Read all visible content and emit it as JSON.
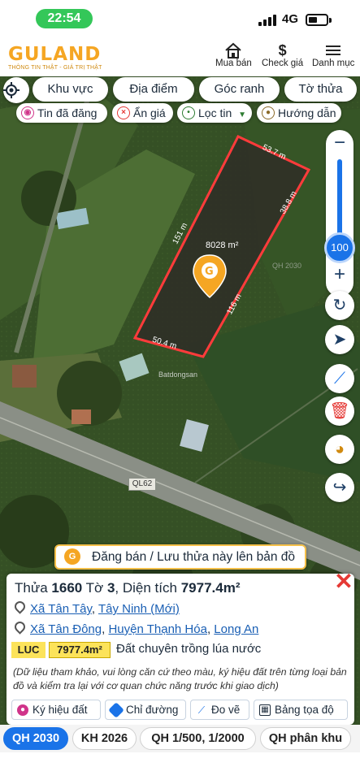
{
  "status": {
    "time": "22:54",
    "network": "4G"
  },
  "header": {
    "logo": "GULAND",
    "tagline": "THÔNG TIN THẬT - GIÁ TRỊ THẬT",
    "buttons": [
      {
        "label": "Mua bán",
        "icon": "house-icon"
      },
      {
        "label": "Check giá",
        "icon": "dollar-icon"
      },
      {
        "label": "Danh mục",
        "icon": "menu-icon"
      }
    ]
  },
  "map": {
    "top_pills": [
      "Khu vực",
      "Địa điểm",
      "Góc ranh",
      "Tờ thửa"
    ],
    "chips": [
      "Tin đã đăng",
      "Ẩn giá",
      "Lọc tin",
      "Hướng dẫn"
    ],
    "parcel": {
      "area_label": "8028 m²",
      "edges": [
        "53.7 m",
        "38.8 m",
        "116 m",
        "50.4 m",
        "151 m"
      ]
    },
    "road_label": "QL62",
    "watermark": "Batdongsan",
    "faded_label": "QH 2030",
    "zoom": {
      "value": "100",
      "minus": "−",
      "plus": "+"
    },
    "cta": "Đăng bán / Lưu thửa này lên bản đồ"
  },
  "panel": {
    "title_prefix": "Thửa",
    "parcel_no": "1660",
    "sheet_prefix": "Tờ",
    "sheet_no": "3",
    "area_prefix": ", Diện tích",
    "area": "7977.4m²",
    "new_address": {
      "commune": "Xã Tân Tây",
      "province": "Tây Ninh (Mới)"
    },
    "old_address": {
      "commune": "Xã Tân Đông",
      "district": "Huyện Thạnh Hóa",
      "province": "Long An"
    },
    "land_code": "LUC",
    "land_area": "7977.4m²",
    "land_type": "Đất chuyên trồng lúa nước",
    "note": "(Dữ liệu tham khảo, vui lòng căn cứ theo màu, ký hiệu đất trên từng loại bản đồ và kiểm tra lại với cơ quan chức năng trước khi giao dịch)",
    "actions": [
      "Ký hiệu đất",
      "Chỉ đường",
      "Đo vẽ",
      "Bảng tọa độ"
    ]
  },
  "bottom_tabs": [
    "QH 2030",
    "KH 2026",
    "QH 1/500, 1/2000",
    "QH phân khu"
  ],
  "colors": {
    "accent": "#1a73e8",
    "brand": "#f5a623",
    "parcel_border": "#ff3b3b",
    "close": "#e53935"
  }
}
